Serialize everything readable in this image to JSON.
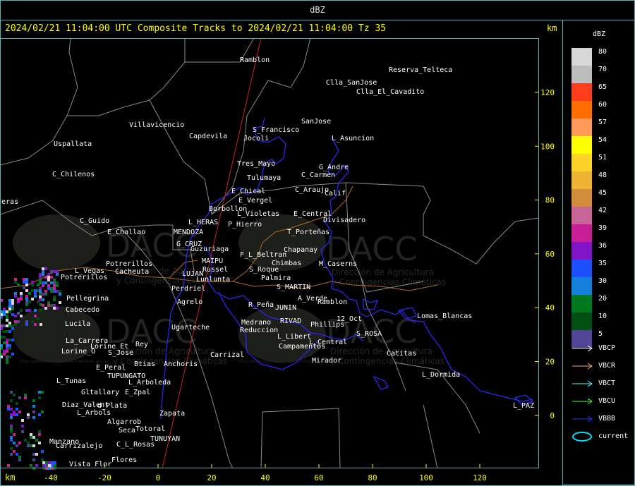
{
  "window": {
    "title": "dBZ"
  },
  "status": {
    "text": "2024/02/21 11:04:00 UTC Composite Tracks to 2024/02/21 11:04:00 Tz 35",
    "km_label_top": "km",
    "km_label_bottom": "km"
  },
  "axes": {
    "x_ticks": [
      "-40",
      "-20",
      "0",
      "20",
      "40",
      "60",
      "80",
      "100",
      "120"
    ],
    "y_ticks": [
      "120",
      "100",
      "80",
      "60",
      "40",
      "20",
      "0"
    ]
  },
  "watermark": {
    "logo": "DACC",
    "line1": "Dirección de Agricultura",
    "line2": "y Contingencias Climáticas",
    "url": "http://www.contingencias.mendoza.gov.ar"
  },
  "place_names": [
    "Ramblon",
    "Reserva_Telteca",
    "Clla_SanJose",
    "Clla_El_Cavadito",
    "Villavicencio",
    "Capdevila",
    "S_Francisco",
    "Jocoli",
    "SanJose",
    "L_Asuncion",
    "Uspallata",
    "C_Chilenos",
    "Tres_Mayo",
    "G_Andre",
    "C_Carmen",
    "Tulumaya",
    "E_Chical",
    "C_Araujo",
    "Calif",
    "E_Vergel",
    "deras",
    "Borbollon",
    "E_Central",
    "Divisadero",
    "C_Guido",
    "L_HERAS",
    "L_Violetas",
    "P_Hierro",
    "E_Challao",
    "MENDOZA",
    "T_Porteñas",
    "G_CRUZ",
    "Guzuriaga",
    "F_L_Beltran",
    "Chapanay",
    "MAIPU",
    "Chimbas",
    "M_Caserns",
    "L_Vegas",
    "Potrerillos",
    "Cacheuta",
    "Russel",
    "S_Roque",
    "LUJAN",
    "Palmira",
    "Potrerillos",
    "Lunlunta",
    "S_MARTIN",
    "Perdriel",
    "Pellegrina",
    "A_Verde",
    "Agrelo",
    "Ramblon",
    "R_Peña",
    "JUNIN",
    "Cabecedo",
    "Lomas_Blancas",
    "RIVAD",
    "12_Oct",
    "Lucila",
    "Ugarteche",
    "Medrano",
    "Phillips",
    "Reduccion",
    "L_Libert",
    "S_ROSA",
    "La_Carrera",
    "L_Central",
    "Lorine_Et",
    "Campamentos",
    "S_Jose",
    "Catitas",
    "Lorine_O",
    "Carrizal",
    "Mirador",
    "E_Peral",
    "Btias",
    "Anchoris",
    "L_Dormida",
    "TUPUNGATO",
    "L_Tunas",
    "L_Arboleda",
    "Gltallary",
    "E_Zpal",
    "L_PAZ",
    "Diaz_Valent",
    "d_Plata",
    "Zapata",
    "L_Arbols",
    "Algarrob",
    "Seca",
    "Totoral",
    "TUNUYAN",
    "Manzano",
    "Carrizalejo",
    "C_L_Rosas",
    "Vista_Flor",
    "Flores",
    "Rey"
  ],
  "colorscale": {
    "title": "dBZ",
    "levels": [
      {
        "label": "80",
        "color": "#d7d7d7"
      },
      {
        "label": "70",
        "color": "#bdbdbd"
      },
      {
        "label": "65",
        "color": "#ff3c1e"
      },
      {
        "label": "60",
        "color": "#ff6e00"
      },
      {
        "label": "57",
        "color": "#ff9a5a"
      },
      {
        "label": "54",
        "color": "#ffff00"
      },
      {
        "label": "51",
        "color": "#ffd22a"
      },
      {
        "label": "48",
        "color": "#f0b432"
      },
      {
        "label": "45",
        "color": "#d28c3c"
      },
      {
        "label": "42",
        "color": "#c86496"
      },
      {
        "label": "39",
        "color": "#c81e96"
      },
      {
        "label": "36",
        "color": "#8214c8"
      },
      {
        "label": "35",
        "color": "#1e50ff"
      },
      {
        "label": "30",
        "color": "#1482dc"
      },
      {
        "label": "20",
        "color": "#00781e"
      },
      {
        "label": "10",
        "color": "#005014"
      },
      {
        "label": "5",
        "color": "#504696"
      }
    ]
  },
  "legend": [
    {
      "label": "VBCP",
      "color": "#ffffff"
    },
    {
      "label": "VBCR",
      "color": "#ffaa88"
    },
    {
      "label": "VBCT",
      "color": "#66ffff"
    },
    {
      "label": "VBCU",
      "color": "#44ff44"
    },
    {
      "label": "VBBB",
      "color": "#3333ff"
    },
    {
      "label": "current",
      "color": "#00ddff"
    }
  ]
}
